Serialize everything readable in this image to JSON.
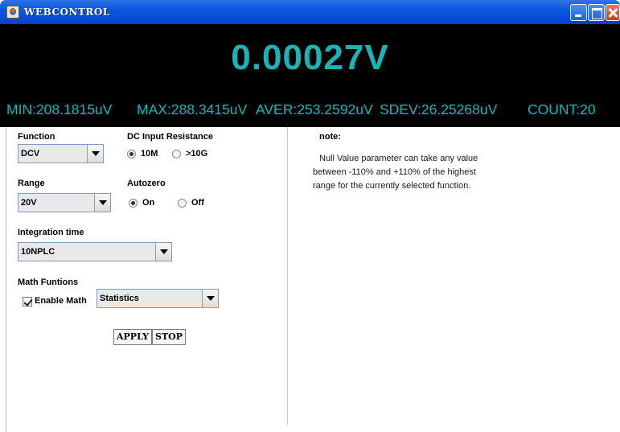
{
  "window": {
    "title": "WEBCONTROL",
    "icon": "java-app-icon",
    "controls": [
      "minimize-icon",
      "maximize-icon",
      "close-icon"
    ]
  },
  "display": {
    "reading": "0.00027V",
    "min": "MIN:208.1815uV",
    "max": "MAX:288.3415uV",
    "aver": "AVER:253.2592uV",
    "sdev": "SDEV:26.25268uV",
    "count": "COUNT:20",
    "text_color": "#19b5b6",
    "background": "#000000"
  },
  "controls": {
    "function": {
      "label": "Function",
      "value": "DCV"
    },
    "dc_input_resistance": {
      "label": "DC Input Resistance",
      "options": [
        "10M",
        ">10G"
      ],
      "selected": "10M"
    },
    "range": {
      "label": "Range",
      "value": "20V"
    },
    "autozero": {
      "label": "Autozero",
      "options": [
        "On",
        "Off"
      ],
      "selected": "On"
    },
    "integration_time": {
      "label": "Integration time",
      "value": "10NPLC"
    },
    "math": {
      "label": "Math Funtions",
      "enable_label": "Enable Math",
      "enabled": true,
      "value": "Statistics"
    },
    "apply_label": "APPLY",
    "stop_label": "STOP"
  },
  "note": {
    "title": "note:",
    "lines": [
      "Null Value parameter can take any value",
      "between -110% and +110% of the highest",
      "range for the currently selected function."
    ]
  }
}
